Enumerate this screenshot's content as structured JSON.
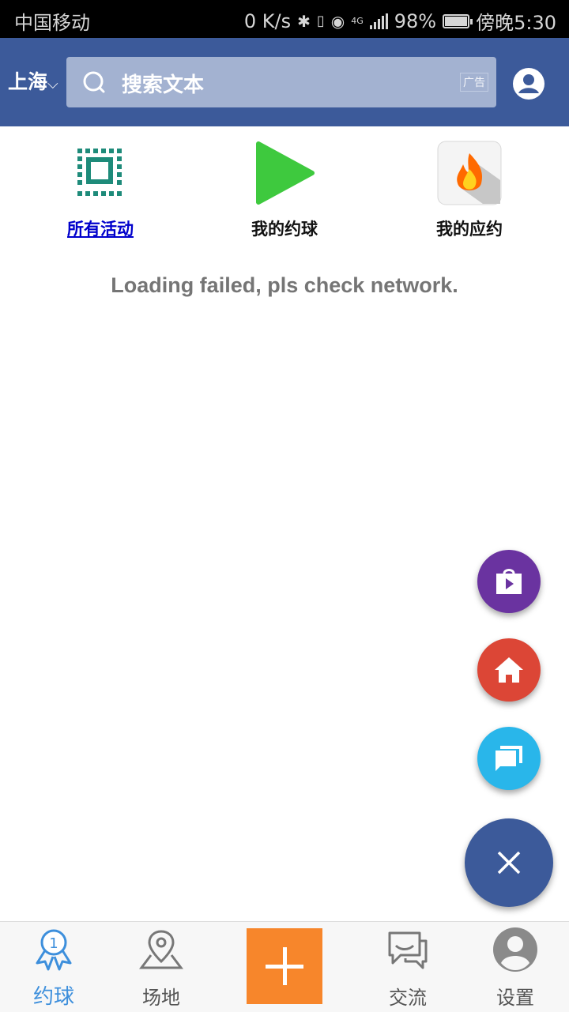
{
  "status_bar": {
    "carrier": "中国移动",
    "network_speed": "0 K/s",
    "network_type": "4G",
    "battery": "98%",
    "battery_level": 0.98,
    "time": "傍晚5:30"
  },
  "header": {
    "city": "上海",
    "search_placeholder": "搜索文本",
    "ad_label": "广告",
    "background": "#3c5a9a"
  },
  "quick_links": [
    {
      "label": "所有活动",
      "icon": "all-activities-icon",
      "active": true
    },
    {
      "label": "我的约球",
      "icon": "play-icon"
    },
    {
      "label": "我的应约",
      "icon": "flame-icon"
    }
  ],
  "message": "Loading failed, pls check network.",
  "fabs": [
    {
      "icon": "store-icon",
      "color": "#6a33a0"
    },
    {
      "icon": "home-icon",
      "color": "#dc4636"
    },
    {
      "icon": "chat-icon",
      "color": "#29b6ea"
    },
    {
      "icon": "close-icon",
      "color": "#3c5a9a"
    }
  ],
  "bottom_nav": {
    "tabs": [
      {
        "label": "约球",
        "icon": "medal-icon",
        "active": true
      },
      {
        "label": "场地",
        "icon": "location-pin-icon"
      },
      {
        "label": "",
        "icon": "plus-icon"
      },
      {
        "label": "交流",
        "icon": "chat-bubbles-icon"
      },
      {
        "label": "设置",
        "icon": "user-icon"
      }
    ],
    "active_color": "#3d8fdc",
    "plus_color": "#f7862b"
  }
}
